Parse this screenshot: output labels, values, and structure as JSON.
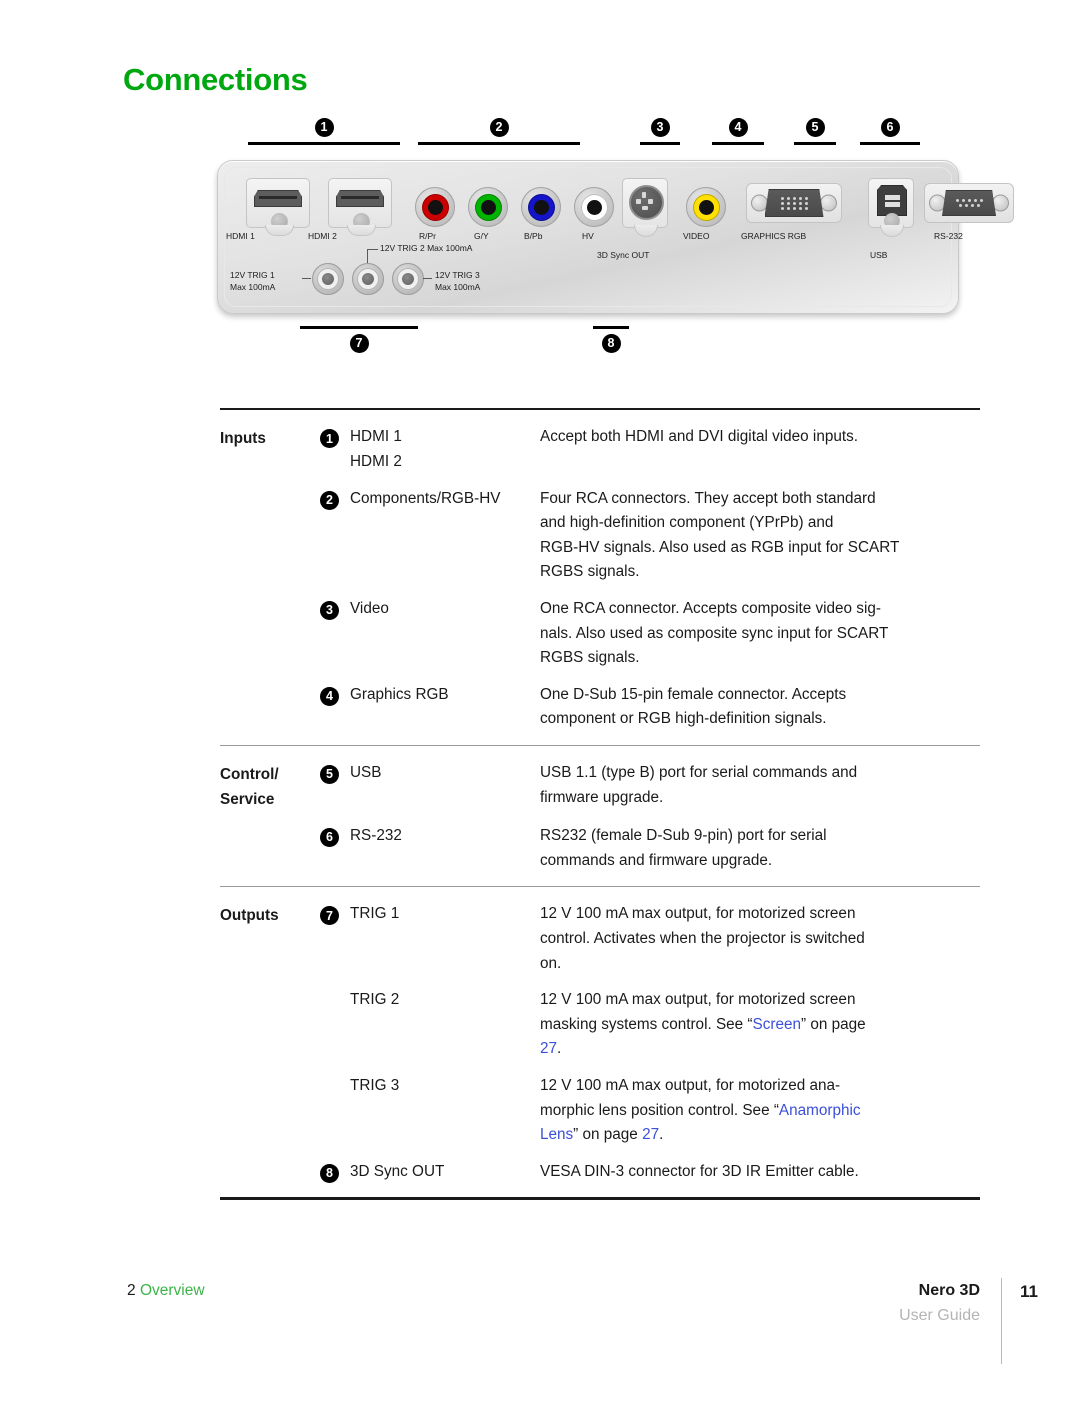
{
  "heading": "Connections",
  "colors": {
    "heading_green": "#00a80f",
    "link_blue": "#3b4fd8",
    "footer_green": "#3cb44a",
    "footer_gray": "#b4b4b4"
  },
  "callouts_top": [
    {
      "num": "❶",
      "n": "1"
    },
    {
      "num": "❷",
      "n": "2"
    },
    {
      "num": "❸",
      "n": "3"
    },
    {
      "num": "❹",
      "n": "4"
    },
    {
      "num": "❺",
      "n": "5"
    },
    {
      "num": "❻",
      "n": "6"
    }
  ],
  "callouts_bottom": [
    {
      "num": "❼",
      "n": "7"
    },
    {
      "num": "❽",
      "n": "8"
    }
  ],
  "panel": {
    "ports": [
      {
        "name": "hdmi-1-port",
        "label": "HDMI 1"
      },
      {
        "name": "hdmi-2-port",
        "label": "HDMI 2"
      },
      {
        "name": "rca-rpr-jack",
        "label": "R/Pr",
        "color": "#cc0000"
      },
      {
        "name": "rca-gy-jack",
        "label": "G/Y",
        "color": "#00b400"
      },
      {
        "name": "rca-bpb-jack",
        "label": "B/Pb",
        "color": "#1414c8"
      },
      {
        "name": "rca-hv-jack",
        "label": "HV",
        "color": "#ffffff"
      },
      {
        "name": "3d-sync-out-port",
        "label": "3D Sync OUT"
      },
      {
        "name": "video-jack",
        "label": "VIDEO",
        "color": "#ffe000"
      },
      {
        "name": "graphics-rgb-port",
        "label": "GRAPHICS RGB"
      },
      {
        "name": "usb-port",
        "label": "USB"
      },
      {
        "name": "rs232-port",
        "label": "RS-232"
      }
    ],
    "triggers": [
      {
        "name": "trig-1-jack",
        "label_line1": "12V TRIG 1",
        "label_line2": "Max 100mA"
      },
      {
        "name": "trig-2-jack",
        "label_line1": "12V TRIG 2 Max 100mA",
        "label_line2": ""
      },
      {
        "name": "trig-3-jack",
        "label_line1": "12V TRIG 3",
        "label_line2": "Max 100mA"
      }
    ]
  },
  "table": {
    "sections": [
      {
        "group": "Inputs",
        "rows": [
          {
            "bullet": "❶",
            "names": [
              "HDMI 1",
              "HDMI 2"
            ],
            "desc_lines": [
              "Accept both HDMI and DVI digital video inputs."
            ]
          },
          {
            "bullet": "❷",
            "names": [
              "Components/RGB-HV"
            ],
            "desc_lines": [
              "Four RCA connectors. They accept both standard",
              "and high-definition component (YPrPb) and",
              "RGB-HV signals. Also used as RGB input for SCART",
              "RGBS signals."
            ]
          },
          {
            "bullet": "❸",
            "names": [
              "Video"
            ],
            "desc_lines": [
              "One RCA connector. Accepts composite video sig-",
              "nals. Also used as composite sync input for SCART",
              "RGBS signals."
            ]
          },
          {
            "bullet": "❹",
            "names": [
              "Graphics RGB"
            ],
            "desc_lines": [
              "One D-Sub 15-pin female connector. Accepts",
              "component or RGB high-definition signals."
            ]
          }
        ]
      },
      {
        "group": "Control/ Service",
        "group_lines": [
          "Control/",
          "Service"
        ],
        "rows": [
          {
            "bullet": "❺",
            "names": [
              "USB"
            ],
            "desc_lines": [
              "USB 1.1 (type B) port for serial commands and",
              "firmware upgrade."
            ]
          },
          {
            "bullet": "❻",
            "names": [
              "RS-232"
            ],
            "desc_lines": [
              "RS232 (female D-Sub 9-pin) port for serial",
              "commands and firmware upgrade."
            ]
          }
        ]
      },
      {
        "group": "Outputs",
        "rows": [
          {
            "bullet": "❼",
            "names": [
              "TRIG 1"
            ],
            "desc_lines": [
              "12 V 100 mA max output, for motorized screen",
              "control. Activates when the projector is switched",
              "on."
            ]
          },
          {
            "bullet": "",
            "names": [
              "TRIG 2"
            ],
            "desc_rich": [
              [
                {
                  "t": "12 V 100 mA max output, for motorized screen"
                }
              ],
              [
                {
                  "t": "masking systems control. See “"
                },
                {
                  "t": "Screen",
                  "link": true
                },
                {
                  "t": "” on page"
                }
              ],
              [
                {
                  "t": "27",
                  "link": true
                },
                {
                  "t": "."
                }
              ]
            ]
          },
          {
            "bullet": "",
            "names": [
              "TRIG 3"
            ],
            "desc_rich": [
              [
                {
                  "t": "12 V 100 mA max output, for motorized ana-"
                }
              ],
              [
                {
                  "t": "morphic lens position control. See “"
                },
                {
                  "t": "Anamorphic",
                  "link": true
                }
              ],
              [
                {
                  "t": "Lens",
                  "link": true
                },
                {
                  "t": "” on page "
                },
                {
                  "t": "27",
                  "link": true
                },
                {
                  "t": "."
                }
              ]
            ]
          },
          {
            "bullet": "❽",
            "names": [
              "3D Sync OUT"
            ],
            "desc_lines": [
              "VESA DIN-3 connector for 3D IR Emitter cable."
            ]
          }
        ]
      }
    ]
  },
  "footer": {
    "chapter_number": "2",
    "chapter_name": "Overview",
    "brand": "Nero 3D",
    "guide": "User Guide",
    "page_number": "11"
  }
}
